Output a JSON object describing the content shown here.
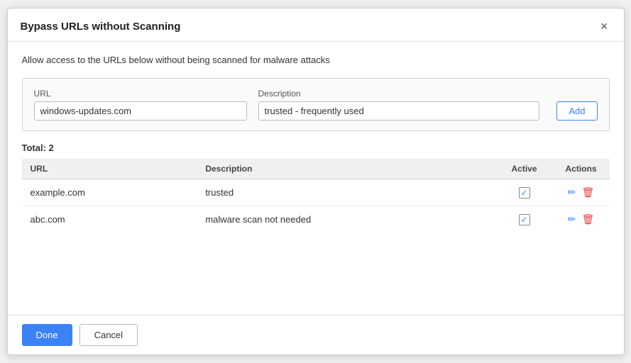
{
  "dialog": {
    "title": "Bypass URLs without Scanning",
    "description": "Allow access to the URLs below without being scanned for malware attacks",
    "close_label": "×"
  },
  "form": {
    "url_label": "URL",
    "url_placeholder": "windows-updates.com",
    "desc_label": "Description",
    "desc_placeholder": "trusted - frequently used",
    "add_label": "Add"
  },
  "table": {
    "total_label": "Total:",
    "total_count": "2",
    "columns": {
      "url": "URL",
      "description": "Description",
      "active": "Active",
      "actions": "Actions"
    },
    "rows": [
      {
        "url": "example.com",
        "description": "trusted",
        "active": true
      },
      {
        "url": "abc.com",
        "description": "malware scan not needed",
        "active": true
      }
    ]
  },
  "footer": {
    "done_label": "Done",
    "cancel_label": "Cancel"
  }
}
